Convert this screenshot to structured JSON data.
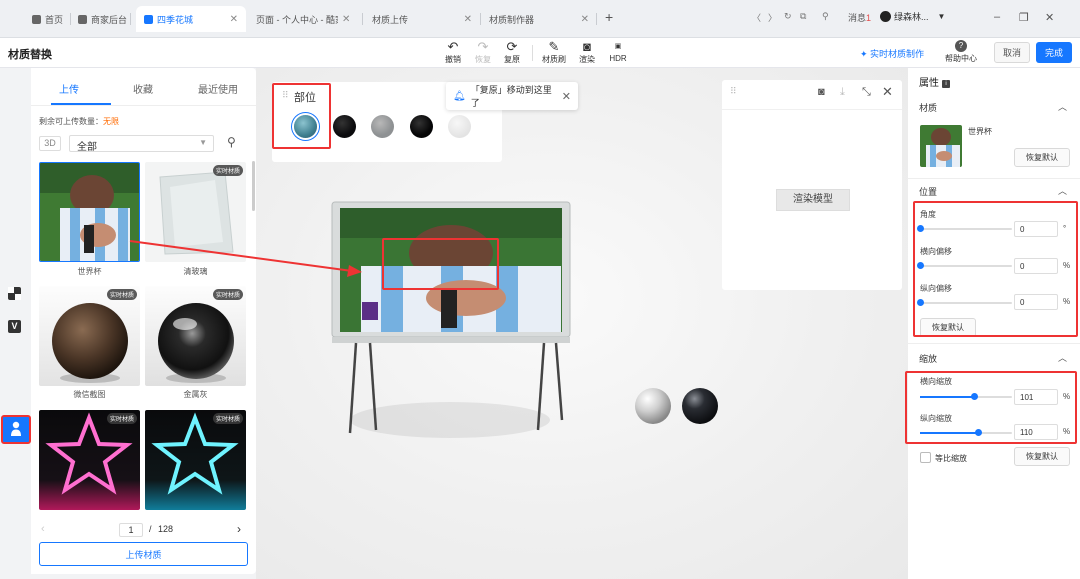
{
  "browser": {
    "tabs": [
      {
        "label": "首页"
      },
      {
        "label": "商家后台"
      },
      {
        "label": "四季花城"
      },
      {
        "label": "页面 - 个人中心 - 酷家"
      },
      {
        "label": "材质上传"
      },
      {
        "label": "材质制作器"
      }
    ],
    "new_tab": "+",
    "messages_label": "消息",
    "messages_count": "1",
    "account_name": "绿森林..."
  },
  "header": {
    "title": "材质替换",
    "tools": [
      {
        "label": "撤销",
        "icon": "undo-icon"
      },
      {
        "label": "恢复",
        "icon": "redo-icon"
      },
      {
        "label": "复原",
        "icon": "reset-icon"
      },
      {
        "label": "材质刷",
        "icon": "brush-icon"
      },
      {
        "label": "渲染",
        "icon": "camera-icon"
      },
      {
        "label": "HDR",
        "icon": "hdr-icon"
      }
    ],
    "realtime_link": "实时材质制作",
    "help_label": "帮助中心",
    "cancel_label": "取消",
    "done_label": "完成"
  },
  "material_panel": {
    "tabs": [
      "上传",
      "收藏",
      "最近使用"
    ],
    "quota_label": "剩余可上传数量：",
    "quota_value": "无限",
    "tag_3d": "3D",
    "filter_value": "全部",
    "realtime_badge": "实时材质",
    "items": [
      {
        "label": "世界杯",
        "badge": false,
        "selected": true
      },
      {
        "label": "清玻璃",
        "badge": true,
        "selected": false
      },
      {
        "label": "微信截图",
        "badge": true,
        "selected": false
      },
      {
        "label": "金属灰",
        "badge": true,
        "selected": false
      },
      {
        "label": "",
        "badge": true,
        "selected": false
      },
      {
        "label": "",
        "badge": true,
        "selected": false
      }
    ],
    "page_current": "1",
    "page_sep": "/",
    "page_total": "128",
    "upload_button": "上传材质"
  },
  "canvas": {
    "parts_title": "部位",
    "swatch_colors": [
      "#3f7f8f",
      "#0b0b0d",
      "#8e9193",
      "#050506",
      "#e7e7e7"
    ],
    "toast_text": "「复原」移动到这里了",
    "render_button": "渲染模型"
  },
  "properties": {
    "title": "属性",
    "material_section": "材质",
    "material_name": "世界杯",
    "restore_label": "恢复默认",
    "position_section": "位置",
    "angle_label": "角度",
    "angle_value": "0",
    "angle_unit": "°",
    "h_offset_label": "横向偏移",
    "h_offset_value": "0",
    "v_offset_label": "纵向偏移",
    "v_offset_value": "0",
    "percent_unit": "%",
    "scale_section": "缩放",
    "h_scale_label": "横向缩放",
    "h_scale_value": "101",
    "v_scale_label": "纵向缩放",
    "v_scale_value": "110",
    "proportional_label": "等比缩放"
  },
  "accent_color": "#1677ff",
  "annotation_color": "#ee3333"
}
